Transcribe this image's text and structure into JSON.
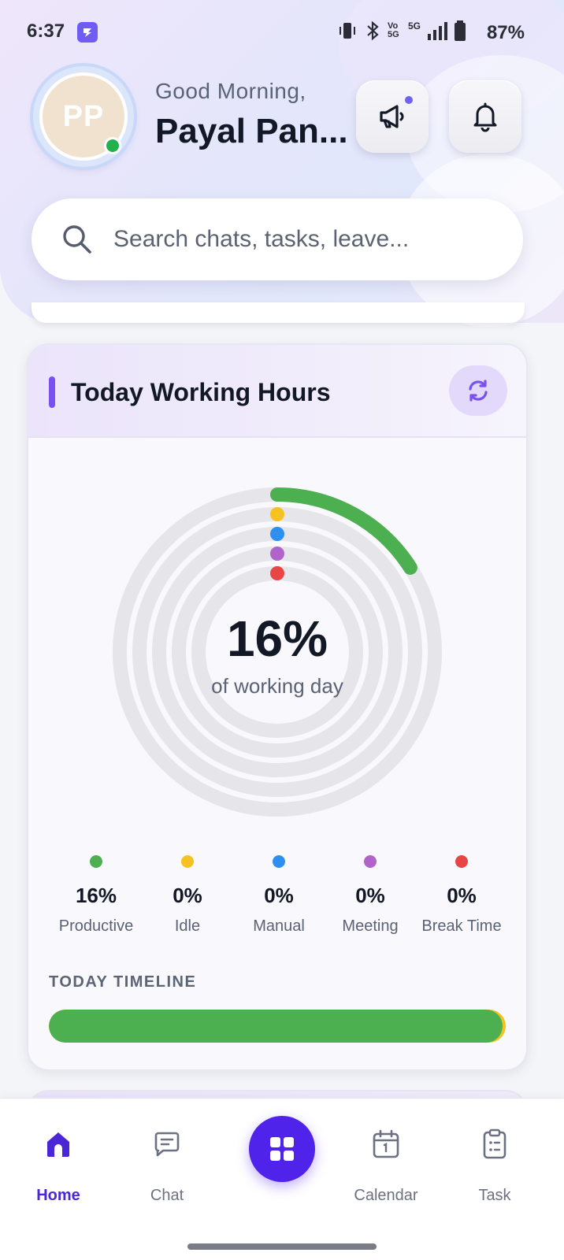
{
  "status_bar": {
    "time": "6:37",
    "battery": "87%",
    "network_label": "5G",
    "volte_label": "Vo 5G"
  },
  "header": {
    "greeting": "Good Morning,",
    "user_name": "Payal Pan...",
    "avatar_initials": "PP",
    "online": true
  },
  "search": {
    "placeholder": "Search chats, tasks, leave..."
  },
  "working_hours": {
    "title": "Today Working Hours",
    "center_value": "16%",
    "center_caption": "of working day",
    "rings": [
      {
        "name": "Productive",
        "color": "#4caf50",
        "percent": 16
      },
      {
        "name": "Idle",
        "color": "#f5c220",
        "percent": 0
      },
      {
        "name": "Manual",
        "color": "#2f8ff0",
        "percent": 0
      },
      {
        "name": "Meeting",
        "color": "#b163c9",
        "percent": 0
      },
      {
        "name": "Break Time",
        "color": "#e84545",
        "percent": 0
      }
    ],
    "legend": [
      {
        "value": "16%",
        "label": "Productive",
        "color": "#4caf50"
      },
      {
        "value": "0%",
        "label": "Idle",
        "color": "#f5c220"
      },
      {
        "value": "0%",
        "label": "Manual",
        "color": "#2f8ff0"
      },
      {
        "value": "0%",
        "label": "Meeting",
        "color": "#b163c9"
      },
      {
        "value": "0%",
        "label": "Break Time",
        "color": "#e84545"
      }
    ],
    "timeline_title": "TODAY TIMELINE",
    "timeline_productive_fraction": 0.993
  },
  "bottom_nav": {
    "items": [
      {
        "label": "Home",
        "icon": "home-icon",
        "active": true
      },
      {
        "label": "Chat",
        "icon": "chat-icon",
        "active": false
      },
      {
        "label": "Calendar",
        "icon": "calendar-icon",
        "active": false
      },
      {
        "label": "Task",
        "icon": "clipboard-icon",
        "active": false
      }
    ],
    "fab_icon": "grid-icon"
  },
  "colors": {
    "accent": "#4f23ea",
    "accent_purple": "#7a50f0",
    "productive": "#4caf50"
  }
}
